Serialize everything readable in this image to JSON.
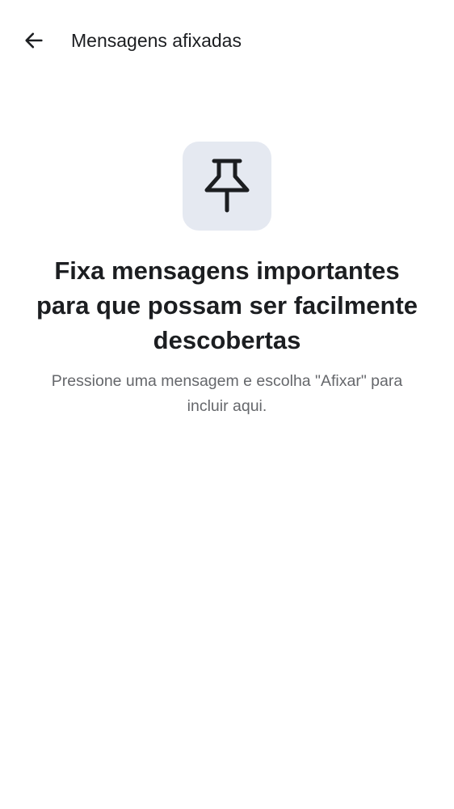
{
  "header": {
    "back_icon": "arrow-left-icon",
    "title": "Mensagens afixadas"
  },
  "empty_state": {
    "icon": "pin-icon",
    "icon_tile_color": "#e5e9f1",
    "headline": "Fixa mensagens importantes para que possam ser facilmente descobertas",
    "subtext": "Pressione uma mensagem e escolha \"Afixar\" para incluir aqui."
  }
}
